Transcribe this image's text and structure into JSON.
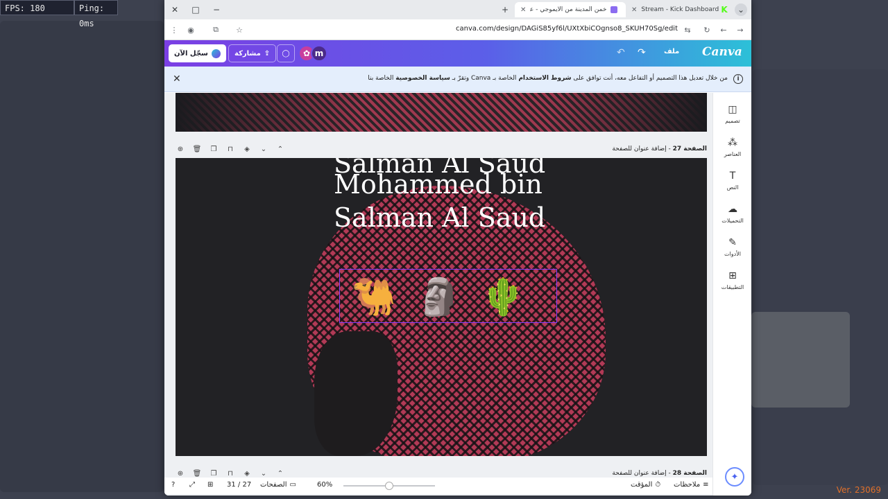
{
  "overlay": {
    "fps": "FPS: 180",
    "ping": "Ping: 0ms",
    "version": "Ver. 23069"
  },
  "browser": {
    "tabs": [
      {
        "title": "Stream - Kick Dashboard"
      },
      {
        "title": "خمن المدينة من الايموجي - عرض"
      }
    ],
    "url": "canva.com/design/DAGiS85yf6l/UXtXbiCOgnso8_SKUH70Sg/edit"
  },
  "canva": {
    "signin_label": "سجّل الآن",
    "share_label": "مشاركة",
    "avatar_letter": "m",
    "file_label": "ملف",
    "logo": "Canva"
  },
  "notice": {
    "text_start": "من خلال تعديل هذا التصميم أو التفاعل معه، أنت توافق على ",
    "terms": "شروط الاستخدام",
    "text_mid": " الخاصة بـ Canva وتقرّ بـ ",
    "privacy": "سياسة الخصوصية",
    "text_end": " الخاصة بنا"
  },
  "sidebar": {
    "items": [
      {
        "label": "تصميم",
        "icon": "layout-icon"
      },
      {
        "label": "العناصر",
        "icon": "elements-icon"
      },
      {
        "label": "النص",
        "icon": "text-icon"
      },
      {
        "label": "التحميلات",
        "icon": "upload-icon"
      },
      {
        "label": "الأدوات",
        "icon": "pen-icon"
      },
      {
        "label": "التطبيقات",
        "icon": "apps-icon"
      }
    ]
  },
  "pages": {
    "current_page": "الصفحة 27",
    "current_title": " - إضافة عنوان للصفحة",
    "next_page": "الصفحة 28",
    "next_title": " - إضافة عنوان للصفحة",
    "slide_lines": [
      "Salman Al Saud",
      "Mohammed bin",
      "Salman Al Saud"
    ],
    "emojis": [
      "🐫",
      "🗿",
      "🌵"
    ]
  },
  "bottom": {
    "notes_label": "ملاحظات",
    "timer_label": "المؤقت",
    "zoom": "60%",
    "zoom_level_fraction": 0.5,
    "pages_label": "الصفحات",
    "page_count": "31 / 27"
  }
}
